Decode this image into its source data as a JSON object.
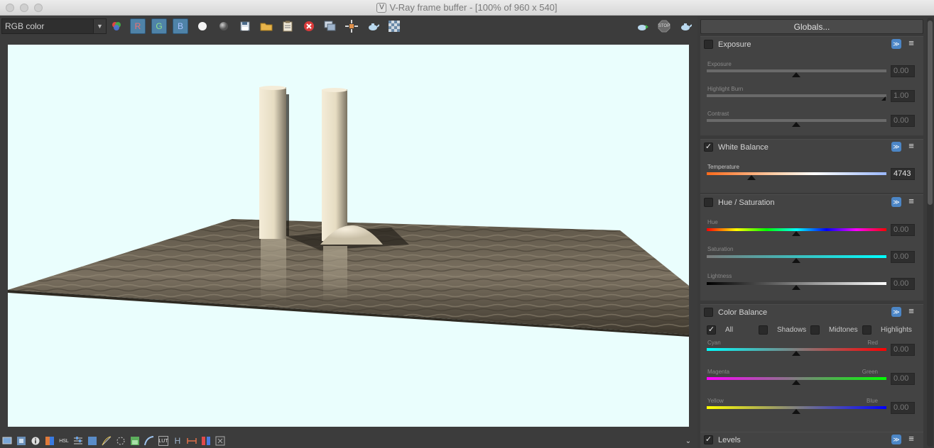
{
  "window": {
    "title": "V-Ray frame buffer - [100% of 960 x 540]"
  },
  "toolbar": {
    "channel": "RGB color",
    "red_label": "R",
    "green_label": "G",
    "blue_label": "B",
    "icons": [
      "channels-icon",
      "white-circle-icon",
      "gray-circle-icon",
      "save-icon",
      "open-folder-icon",
      "clipboard-icon",
      "clear-icon",
      "duplicate-icon",
      "region-icon",
      "teapot-icon",
      "checker-icon"
    ],
    "right_icons": [
      "render-teapot-icon",
      "stop-icon",
      "interactive-teapot-icon"
    ],
    "stop_label": "STOP"
  },
  "panel": {
    "globals_label": "Globals...",
    "exposure": {
      "title": "Exposure",
      "enabled": false,
      "sliders": [
        {
          "label": "Exposure",
          "value": "0.00",
          "pos": 0.5
        },
        {
          "label": "Highlight Burn",
          "value": "1.00",
          "pos": 1.0
        },
        {
          "label": "Contrast",
          "value": "0.00",
          "pos": 0.5
        }
      ]
    },
    "white_balance": {
      "title": "White Balance",
      "enabled": true,
      "check_mark": "✓",
      "temperature_label": "Temperature",
      "temperature_value": "4743",
      "pos": 0.25
    },
    "hue_saturation": {
      "title": "Hue / Saturation",
      "enabled": false,
      "sliders": [
        {
          "label": "Hue",
          "value": "0.00",
          "pos": 0.5
        },
        {
          "label": "Saturation",
          "value": "0.00",
          "pos": 0.5
        },
        {
          "label": "Lightness",
          "value": "0.00",
          "pos": 0.5
        }
      ]
    },
    "color_balance": {
      "title": "Color Balance",
      "enabled": false,
      "options": [
        {
          "label": "All",
          "checked": true
        },
        {
          "label": "Shadows",
          "checked": false
        },
        {
          "label": "Midtones",
          "checked": false
        },
        {
          "label": "Highlights",
          "checked": false
        }
      ],
      "check_mark": "✓",
      "sliders": [
        {
          "left": "Cyan",
          "right": "Red",
          "value": "0.00",
          "pos": 0.5
        },
        {
          "left": "Magenta",
          "right": "Green",
          "value": "0.00",
          "pos": 0.5
        },
        {
          "left": "Yellow",
          "right": "Blue",
          "value": "0.00",
          "pos": 0.5
        }
      ]
    },
    "levels": {
      "title": "Levels",
      "enabled": true,
      "check_mark": "✓"
    }
  },
  "statusbar": {
    "icons": [
      "display-icon",
      "film-icon",
      "info-icon",
      "gradient-icon",
      "hsl-icon",
      "levels-icon",
      "curve-icon",
      "lut-icon",
      "histogram-icon",
      "settings-icon",
      "image-icon",
      "curve-tool-icon",
      "ocio-icon",
      "h-icon",
      "crop-icon",
      "compare-icon",
      "pixel-icon"
    ],
    "hsl_text": "HSL",
    "lut_text": "LUT",
    "h_text": "H"
  },
  "colors": {
    "accent": "#4c86c6",
    "sky": "#eafefd",
    "channel_button": "#4f83a8"
  }
}
